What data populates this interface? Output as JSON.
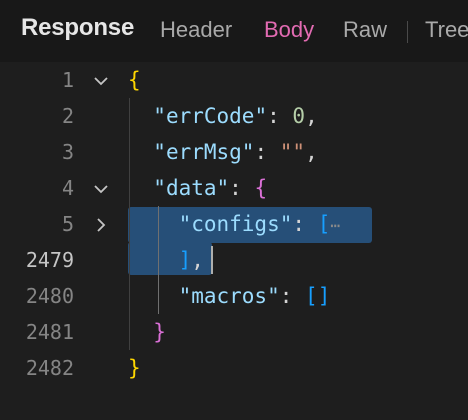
{
  "header": {
    "title": "Response",
    "tabs": [
      {
        "label": "Header",
        "active": false
      },
      {
        "label": "Body",
        "active": true
      },
      {
        "label": "Raw",
        "active": false
      },
      {
        "label": "Tree",
        "active": false
      }
    ]
  },
  "colors": {
    "background": "#1e1e1e",
    "active_tab": "#e26bb2",
    "selection": "#264f78",
    "key": "#9cdcfe",
    "string": "#ce9178",
    "number": "#b5cea8",
    "bracket_level1": "#ffd700",
    "bracket_level2": "#da70d6",
    "bracket_level3": "#179fff"
  },
  "editor": {
    "lines": [
      {
        "number": "1",
        "fold": "chevron-down-icon",
        "tokens": [
          "{"
        ]
      },
      {
        "number": "2",
        "fold": "",
        "tokens": [
          "\"errCode\"",
          ":",
          "0",
          ","
        ]
      },
      {
        "number": "3",
        "fold": "",
        "tokens": [
          "\"errMsg\"",
          ":",
          "\"\"",
          ","
        ]
      },
      {
        "number": "4",
        "fold": "chevron-down-icon",
        "tokens": [
          "\"data\"",
          ":",
          "{"
        ]
      },
      {
        "number": "5",
        "fold": "chevron-right-icon",
        "tokens": [
          "\"configs\"",
          ":",
          "[",
          "⋯"
        ]
      },
      {
        "number": "2479",
        "fold": "",
        "current": true,
        "tokens": [
          "]",
          ","
        ]
      },
      {
        "number": "2480",
        "fold": "",
        "tokens": [
          "\"macros\"",
          ":",
          "[]"
        ]
      },
      {
        "number": "2481",
        "fold": "",
        "tokens": [
          "}"
        ]
      },
      {
        "number": "2482",
        "fold": "",
        "tokens": [
          "}"
        ]
      }
    ]
  }
}
